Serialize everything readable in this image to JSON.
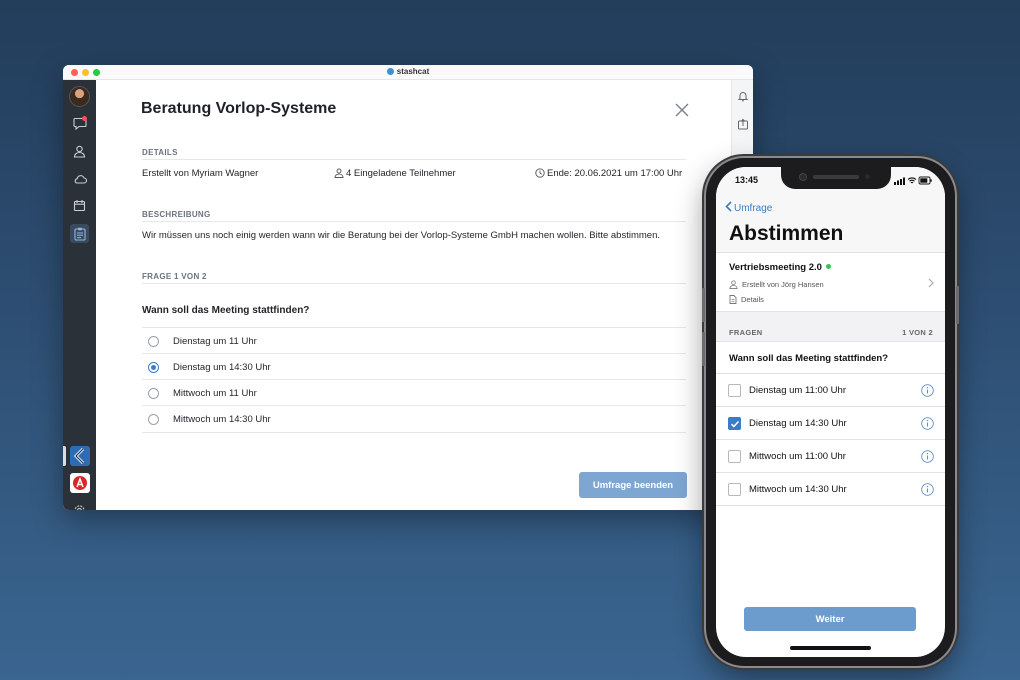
{
  "desktop": {
    "app_name": "stashcat",
    "dialog": {
      "title": "Beratung Vorlop-Systeme",
      "details_label": "DETAILS",
      "created_by": "Erstellt von Myriam Wagner",
      "participants": "4 Eingeladene Teilnehmer",
      "end": "Ende: 20.06.2021 um 17:00 Uhr",
      "description_label": "BESCHREIBUNG",
      "description": "Wir müssen uns noch einig werden wann wir die Beratung bei der Vorlop-Systeme GmbH machen wollen. Bitte abstimmen.",
      "question_counter": "FRAGE 1 VON 2",
      "question": "Wann soll das Meeting stattfinden?",
      "options": [
        {
          "label": "Dienstag um 11 Uhr",
          "selected": false
        },
        {
          "label": "Dienstag um 14:30 Uhr",
          "selected": true
        },
        {
          "label": "Mittwoch um 11 Uhr",
          "selected": false
        },
        {
          "label": "Mittwoch um 14:30 Uhr",
          "selected": false
        }
      ],
      "end_button": "Umfrage beenden"
    },
    "sidebar_icons": [
      "avatar",
      "chat-icon",
      "contacts-icon",
      "cloud-icon",
      "calendar-icon",
      "survey-icon",
      "app-k-icon",
      "app-a-icon",
      "settings-icon"
    ],
    "right_icons": [
      "bell-icon",
      "share-icon"
    ]
  },
  "phone": {
    "time": "13:45",
    "back_label": "Umfrage",
    "title": "Abstimmen",
    "survey_name": "Vertriebsmeeting 2.0",
    "created_by": "Erstellt von Jörg Hansen",
    "details": "Details",
    "section_label": "FRAGEN",
    "section_counter": "1 VON 2",
    "question": "Wann soll das Meeting stattfinden?",
    "options": [
      {
        "label": "Dienstag um 11:00 Uhr",
        "checked": false
      },
      {
        "label": "Dienstag um 14:30 Uhr",
        "checked": true
      },
      {
        "label": "Mittwoch um 11:00 Uhr",
        "checked": false
      },
      {
        "label": "Mittwoch um 14:30 Uhr",
        "checked": false
      }
    ],
    "next_button": "Weiter"
  },
  "colors": {
    "accent": "#3b7cc4",
    "button": "#7ea6d3",
    "sidebar": "#2b3139",
    "online": "#34c759"
  }
}
